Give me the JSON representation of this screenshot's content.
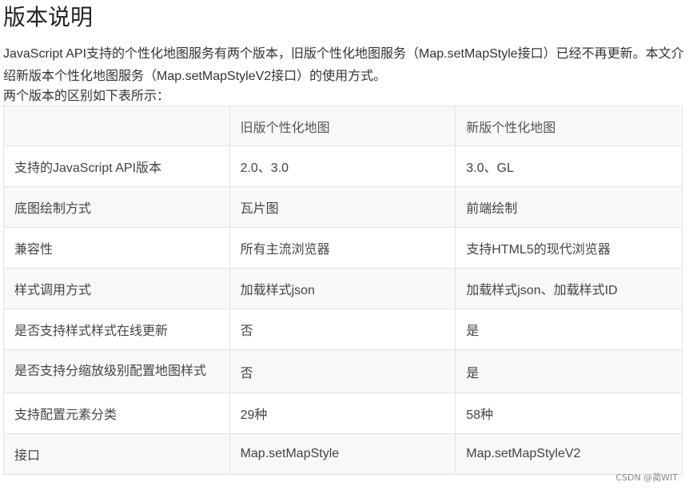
{
  "title": "版本说明",
  "intro": "JavaScript API支持的个性化地图服务有两个版本，旧版个性化地图服务（Map.setMapStyle接口）已经不再更新。本文介绍新版本个性化地图服务（Map.setMapStyleV2接口）的使用方式。",
  "intro2": "两个版本的区别如下表所示：",
  "table": {
    "headers": [
      "",
      "旧版个性化地图",
      "新版个性化地图"
    ],
    "rows": [
      [
        "支持的JavaScript API版本",
        "2.0、3.0",
        "3.0、GL"
      ],
      [
        "底图绘制方式",
        "瓦片图",
        "前端绘制"
      ],
      [
        "兼容性",
        "所有主流浏览器",
        "支持HTML5的现代浏览器"
      ],
      [
        "样式调用方式",
        "加载样式json",
        "加载样式json、加载样式ID"
      ],
      [
        "是否支持样式样式在线更新",
        "否",
        "是"
      ],
      [
        "是否支持分缩放级别配置地图样式",
        "否",
        "是"
      ],
      [
        "支持配置元素分类",
        "29种",
        "58种"
      ],
      [
        "接口",
        "Map.setMapStyle",
        "Map.setMapStyleV2"
      ]
    ]
  },
  "watermark": "CSDN @蔺WIT"
}
